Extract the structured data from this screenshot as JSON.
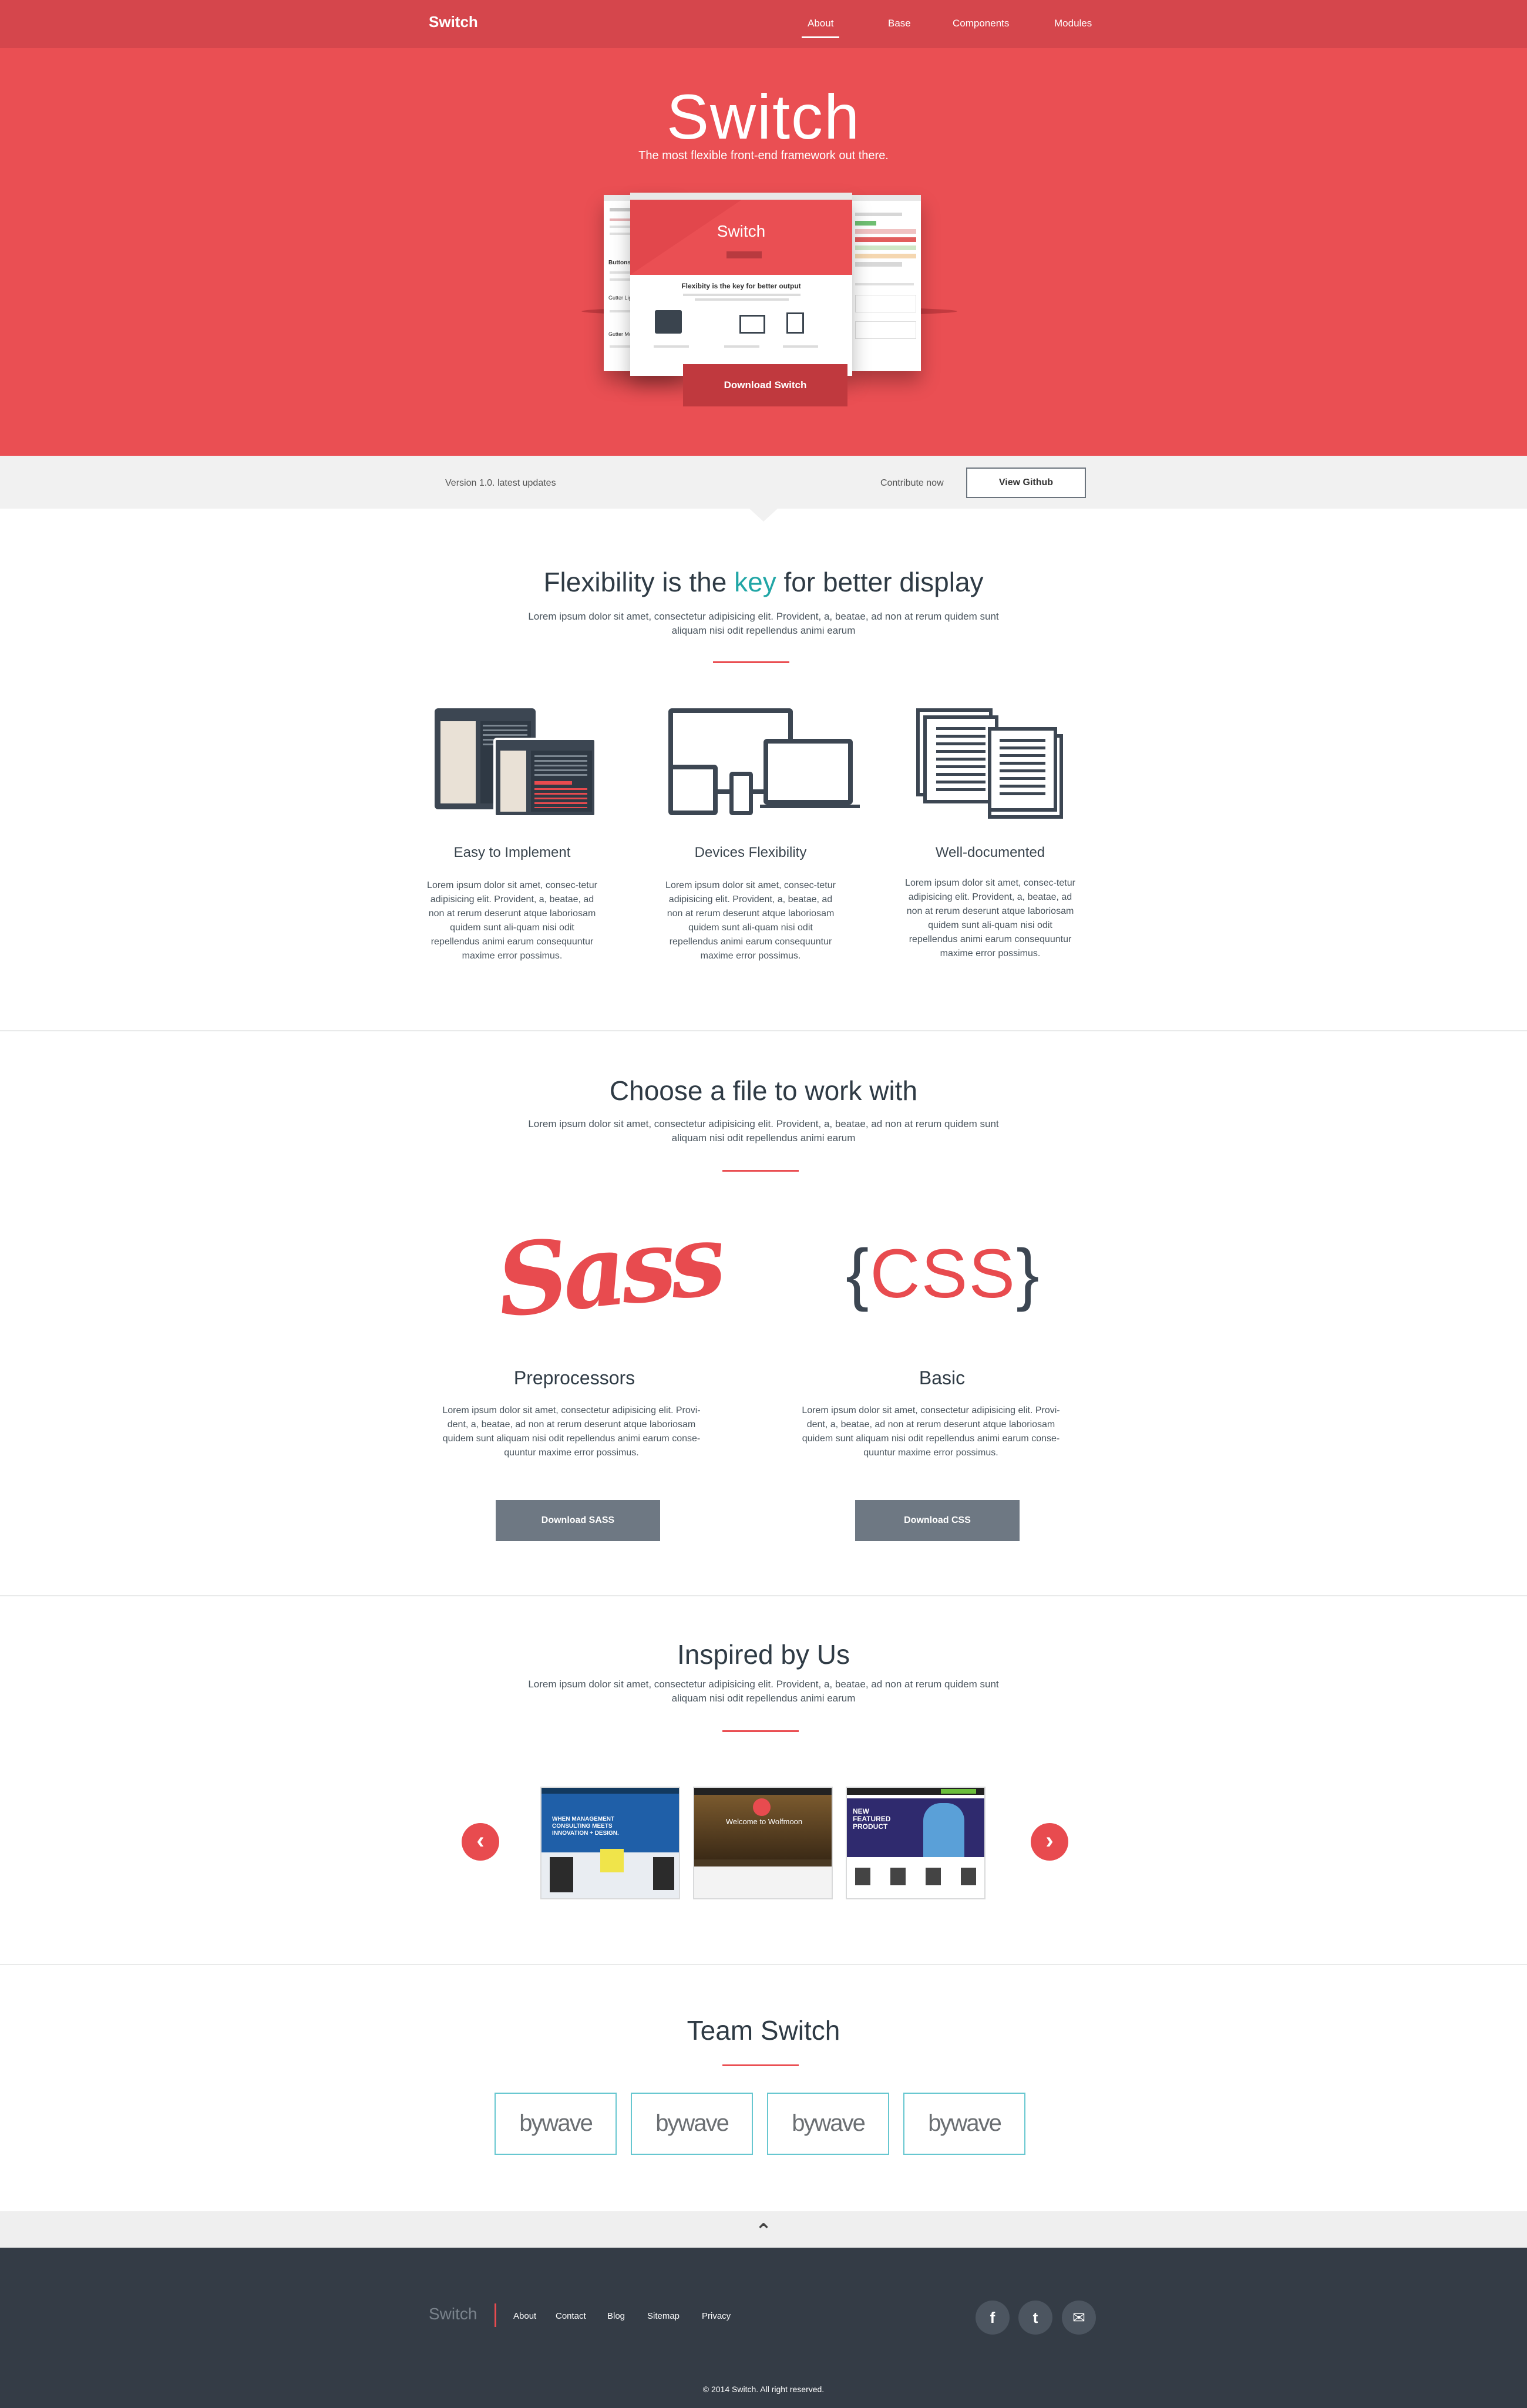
{
  "nav": {
    "brand": "Switch",
    "links": [
      {
        "label": "About",
        "active": true
      },
      {
        "label": "Base"
      },
      {
        "label": "Components"
      },
      {
        "label": "Modules"
      }
    ]
  },
  "hero": {
    "title": "Switch",
    "subtitle": "The most flexible front-end framework out there.",
    "download_label": "Download Switch",
    "mockup": {
      "center_title": "Switch",
      "center_tagline": "Flexibity is the key for better output",
      "left_items": [
        "Buttons",
        "Gutter Light",
        "Gutter Moderate"
      ]
    }
  },
  "subbar": {
    "version_text": "Version 1.0. latest updates",
    "contribute_text": "Contribute now",
    "github_label": "View Github"
  },
  "flexibility": {
    "title_before": "Flexibility is the ",
    "title_key": "key",
    "title_after": " for better display",
    "subtitle": "Lorem ipsum dolor sit amet, consectetur adipisicing elit. Provident, a, beatae, ad non at rerum quidem sunt aliquam nisi odit repellendus animi earum",
    "features": [
      {
        "icon": "browser-windows-icon",
        "title": "Easy to Implement",
        "text": "Lorem ipsum dolor sit amet, consec-tetur adipisicing elit. Provident, a, beatae, ad non at rerum deserunt atque laboriosam quidem sunt ali-quam nisi odit repellendus animi earum consequuntur maxime error possimus."
      },
      {
        "icon": "devices-icon",
        "title": "Devices Flexibility",
        "text": "Lorem ipsum dolor sit amet, consec-tetur adipisicing elit. Provident, a, beatae, ad non at rerum deserunt atque laboriosam quidem sunt ali-quam nisi odit repellendus animi earum consequuntur maxime error possimus."
      },
      {
        "icon": "documents-icon",
        "title": "Well-documented",
        "text": "Lorem ipsum dolor sit amet, consec-tetur adipisicing elit. Provident, a, beatae, ad non at rerum deserunt atque laboriosam quidem sunt ali-quam nisi odit repellendus animi earum consequuntur maxime error possimus."
      }
    ]
  },
  "files": {
    "title": "Choose a file to work with",
    "subtitle": "Lorem ipsum dolor sit amet, consectetur adipisicing elit. Provident, a, beatae, ad non at rerum quidem sunt aliquam nisi odit repellendus animi earum",
    "options": [
      {
        "logo": "Sass",
        "title": "Preprocessors",
        "text": "Lorem ipsum dolor sit amet, consectetur adipisicing elit. Provi-dent, a, beatae, ad non at rerum deserunt atque laboriosam quidem sunt aliquam nisi odit repellendus animi earum conse-quuntur maxime error possimus.",
        "button": "Download SASS"
      },
      {
        "logo_open": "{",
        "logo_text": "CSS",
        "logo_close": "}",
        "title": "Basic",
        "text": "Lorem ipsum dolor sit amet, consectetur adipisicing elit. Provi-dent, a, beatae, ad non at rerum deserunt atque laboriosam quidem sunt aliquam nisi odit repellendus animi earum conse-quuntur maxime error possimus.",
        "button": "Download CSS"
      }
    ]
  },
  "inspired": {
    "title": "Inspired by Us",
    "subtitle": "Lorem ipsum dolor sit amet, consectetur adipisicing elit. Provident, a, beatae, ad non at rerum quidem sunt aliquam nisi odit repellendus animi earum",
    "prev": "‹",
    "next": "›",
    "shots": [
      {
        "headline": "WHEN MANAGEMENT CONSULTING MEETS INNOVATION + DESIGN."
      },
      {
        "headline": "Welcome to Wolfmoon"
      },
      {
        "headline": "NEW FEATURED PRODUCT"
      }
    ]
  },
  "team": {
    "title": "Team Switch",
    "members": [
      "bywave",
      "bywave",
      "bywave",
      "bywave"
    ]
  },
  "to_top": "⌃",
  "footer": {
    "brand": "Switch",
    "links": [
      "About",
      "Contact",
      "Blog",
      "Sitemap",
      "Privacy"
    ],
    "social": [
      {
        "icon": "facebook-icon",
        "glyph": "f"
      },
      {
        "icon": "twitter-icon",
        "glyph": "t"
      },
      {
        "icon": "email-icon",
        "glyph": "✉"
      }
    ],
    "copyright": "© 2014 Switch. All right reserved."
  },
  "colors": {
    "accent": "#ea4f53",
    "nav": "#d5464c",
    "key": "#21a6a6",
    "footer": "#343c46",
    "button_grey": "#6e7883"
  }
}
